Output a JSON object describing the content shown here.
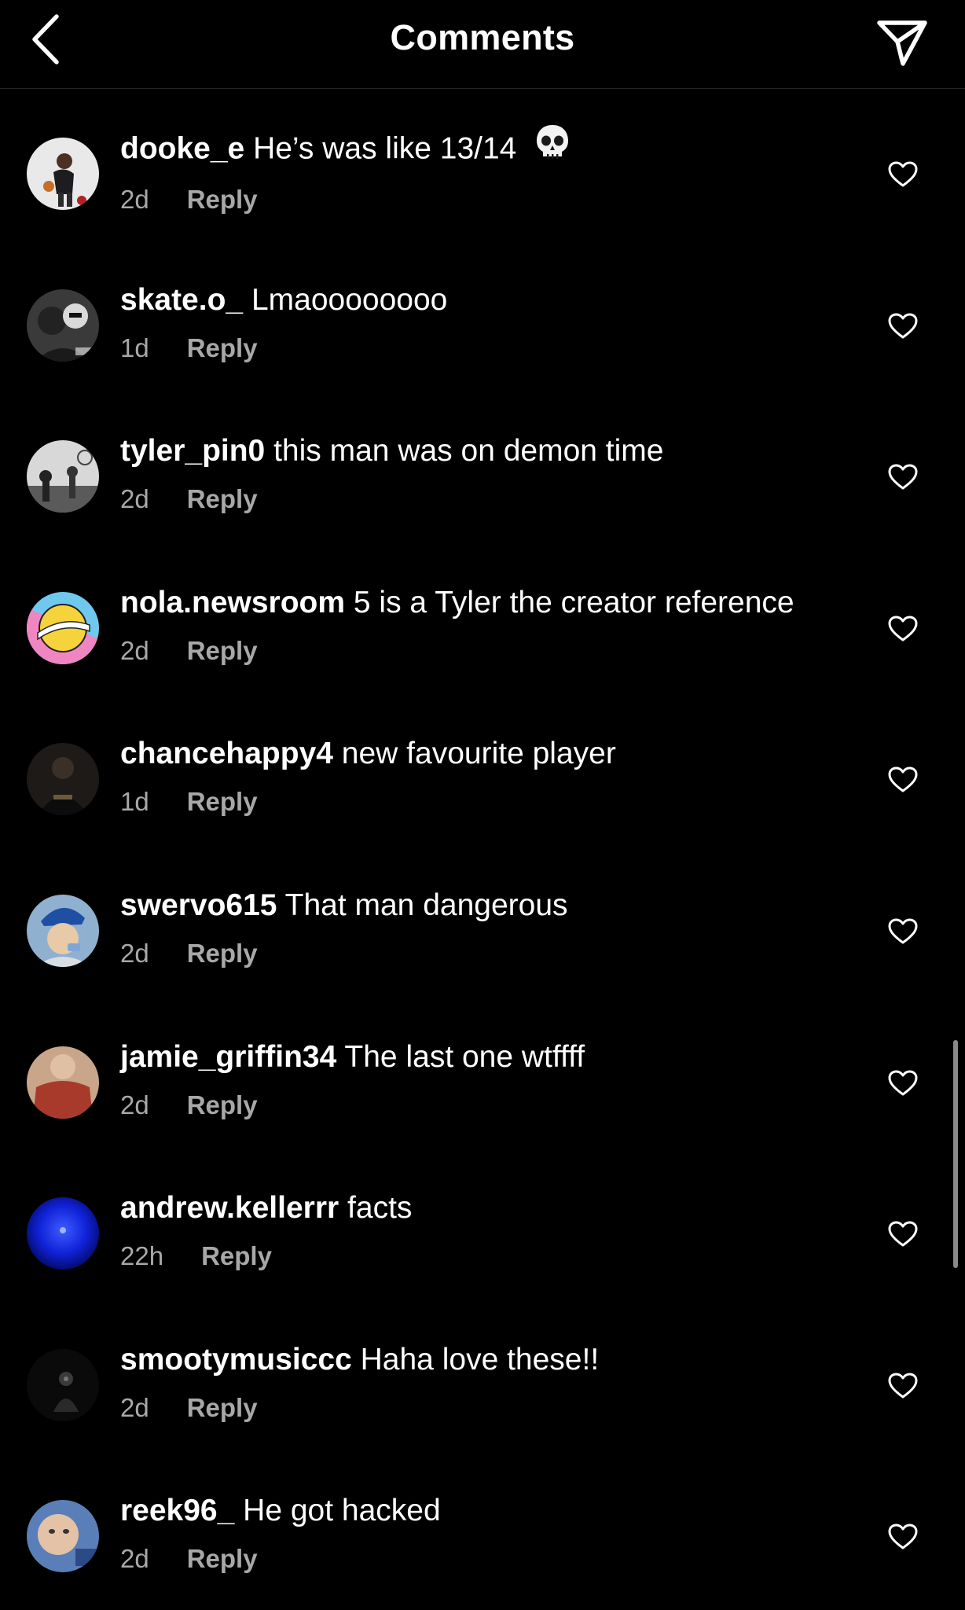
{
  "header": {
    "title": "Comments",
    "back_icon": "chevron-left-icon",
    "share_icon": "paper-plane-icon"
  },
  "reply_label": "Reply",
  "colors": {
    "background": "#000000",
    "secondary_text": "#a8a8a8",
    "divider": "#262626"
  },
  "comments": [
    {
      "username": "dooke_e",
      "text": "He’s was like 13/14",
      "emoji": "skull-icon",
      "time": "2d"
    },
    {
      "username": "skate.o_",
      "text": "Lmaoooooooo",
      "time": "1d"
    },
    {
      "username": "tyler_pin0",
      "text": "this man was on demon time",
      "time": "2d"
    },
    {
      "username": "nola.newsroom",
      "text": "5 is a Tyler the creator reference",
      "time": "2d"
    },
    {
      "username": "chancehappy4",
      "text": "new favourite player",
      "time": "1d"
    },
    {
      "username": "swervo615",
      "text": "That man dangerous",
      "time": "2d"
    },
    {
      "username": "jamie_griffin34",
      "text": "The last one wtffff",
      "time": "2d"
    },
    {
      "username": "andrew.kellerrr",
      "text": "facts",
      "time": "22h"
    },
    {
      "username": "smootymusiccc",
      "text": "Haha love these!!",
      "time": "2d"
    },
    {
      "username": "reek96_",
      "text": "He got hacked",
      "time": "2d"
    }
  ]
}
